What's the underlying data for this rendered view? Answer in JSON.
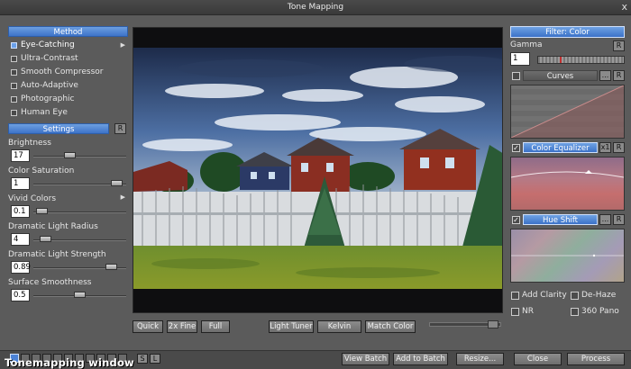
{
  "window": {
    "title": "Tone Mapping",
    "close": "x"
  },
  "method": {
    "header": "Method",
    "options": [
      {
        "label": "Eye-Catching",
        "selected": true,
        "has_arrow": true
      },
      {
        "label": "Ultra-Contrast",
        "selected": false
      },
      {
        "label": "Smooth Compressor",
        "selected": false
      },
      {
        "label": "Auto-Adaptive",
        "selected": false
      },
      {
        "label": "Photographic",
        "selected": false
      },
      {
        "label": "Human Eye",
        "selected": false
      }
    ]
  },
  "settings": {
    "header": "Settings",
    "reset_label": "R",
    "params": [
      {
        "label": "Brightness",
        "value": "17",
        "level": 0.38
      },
      {
        "label": "Color Saturation",
        "value": "1",
        "level": 0.96
      },
      {
        "label": "Vivid Colors",
        "value": "0.1",
        "level": 0.03,
        "has_arrow": true
      },
      {
        "label": "Dramatic Light Radius",
        "value": "4",
        "level": 0.08
      },
      {
        "label": "Dramatic Light Strength",
        "value": "0.89",
        "level": 0.89
      },
      {
        "label": "Surface Smoothness",
        "value": "0.5",
        "level": 0.5
      }
    ]
  },
  "preview_buttons": [
    "Quick",
    "2x Fine",
    "Full"
  ],
  "tool_buttons": [
    "Light Tuner",
    "Kelvin",
    "Match Color"
  ],
  "filter": {
    "header": "Filter: Color",
    "gamma_label": "Gamma",
    "gamma_reset": "R",
    "gamma_value": "1",
    "curves": {
      "label": "Curves",
      "enabled": false,
      "more": "...",
      "reset": "R"
    },
    "color_equalizer": {
      "label": "Color Equalizer",
      "enabled": true,
      "scale": "x1",
      "reset": "R"
    },
    "hue_shift": {
      "label": "Hue Shift",
      "enabled": true,
      "more": "...",
      "reset": "R"
    },
    "checks": [
      {
        "label": "Add Clarity",
        "checked": false
      },
      {
        "label": "De-Haze",
        "checked": false
      },
      {
        "label": "NR",
        "checked": false
      },
      {
        "label": "360 Pano",
        "checked": false
      }
    ]
  },
  "bottom": {
    "caption": "Tonemapping window",
    "s_label": "S",
    "l_label": "L",
    "buttons": [
      "View Batch",
      "Add to Batch",
      "Resize...",
      "Close",
      "Process"
    ]
  },
  "colors": {
    "accent": "#4a7fd4",
    "panel": "#5b5b5b",
    "titlebar": "#3e3e3e"
  }
}
